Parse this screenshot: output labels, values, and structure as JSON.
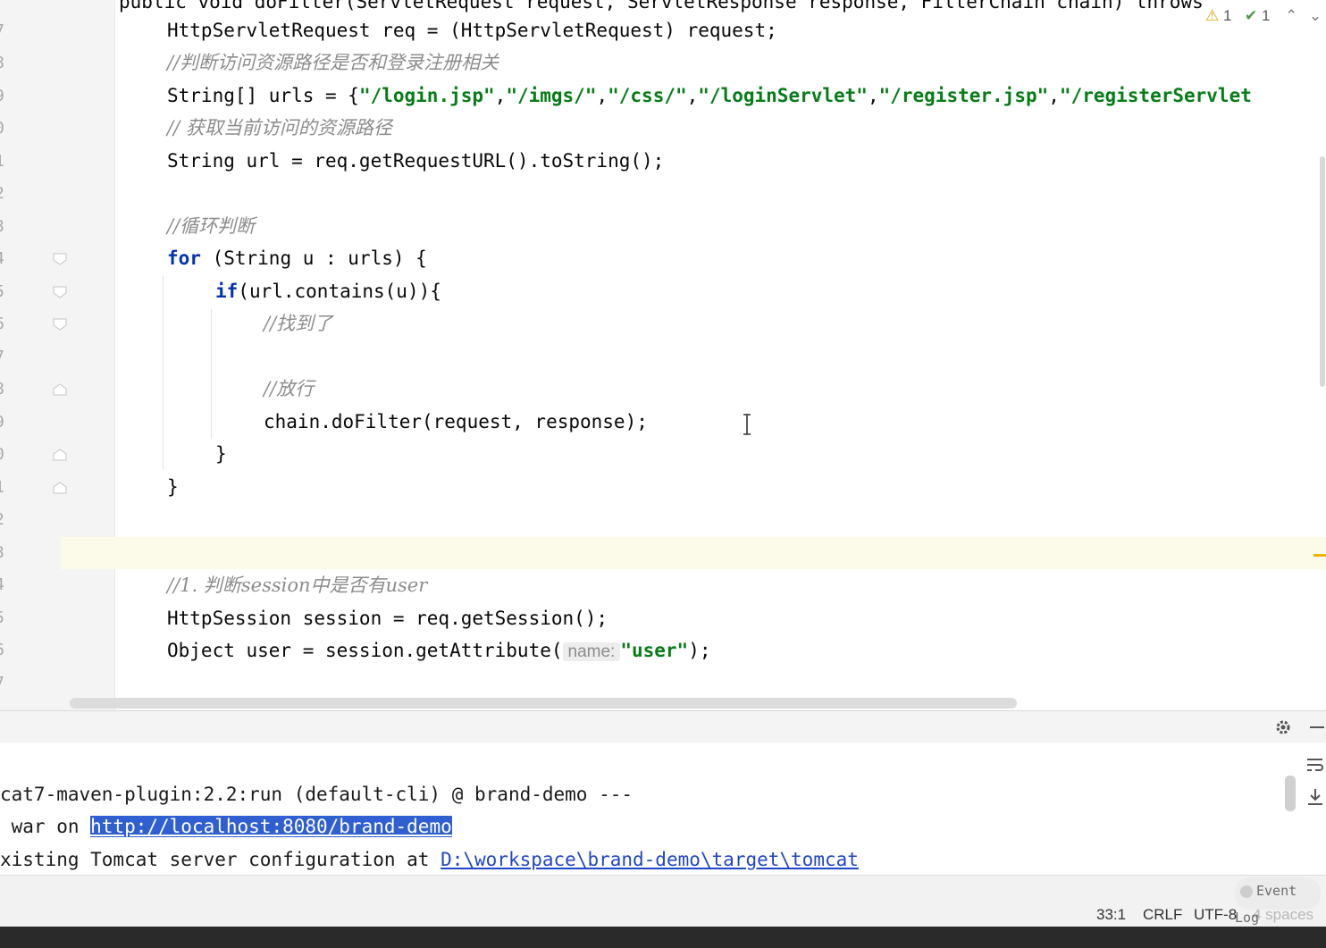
{
  "editor": {
    "line_numbers": [
      "7",
      "8",
      "9",
      "0",
      "1",
      "2",
      "3",
      "4",
      "5",
      "6",
      "7",
      "8",
      "9",
      "0",
      "1",
      "2",
      "3",
      "4",
      "5",
      "6",
      "7"
    ],
    "top_partial": "public void doFilter(ServletRequest request, ServletResponse response, FilterChain chain) throws",
    "code": {
      "l1": {
        "a": "HttpServletRequest req = (HttpServletRequest) request;"
      },
      "l2": {
        "c": "//判断访问资源路径是否和登录注册相关"
      },
      "l3": {
        "a": "String[] urls = {",
        "s1": "\"/login.jsp\"",
        "p1": ",",
        "s2": "\"/imgs/\"",
        "p2": ",",
        "s3": "\"/css/\"",
        "p3": ",",
        "s4": "\"/loginServlet\"",
        "p4": ",",
        "s5": "\"/register.jsp\"",
        "p5": ",",
        "s6": "\"/registerServlet"
      },
      "l4": {
        "c": "// 获取当前访问的资源路径"
      },
      "l5": {
        "a": "String url = req.getRequestURL().toString();"
      },
      "l6": {
        "c": "//循环判断"
      },
      "l7": {
        "k": "for",
        "a": " (String u : urls) {"
      },
      "l8": {
        "k": "if",
        "a": "(url.contains(u)){"
      },
      "l9": {
        "c": "//找到了"
      },
      "l10": {
        "c": "//放行"
      },
      "l11": {
        "a": "chain.doFilter(request, response);"
      },
      "l12": {
        "a": "}"
      },
      "l13": {
        "a": "}"
      },
      "l14": {
        "c": "//1. 判断session中是否有user"
      },
      "l15": {
        "a": "HttpSession session = req.getSession();"
      },
      "l16": {
        "a": "Object user = session.getAttribute(",
        "hint": "name:",
        "s": "\"user\"",
        "b": ");"
      }
    },
    "inspections": {
      "warnings": "1",
      "typos": "1"
    }
  },
  "console": {
    "line1": "cat7-maven-plugin:2.2:run (default-cli) @ brand-demo ---",
    "line2_prefix": " war on ",
    "line2_link": "http://localhost:8080/brand-demo",
    "line3_prefix": "xisting Tomcat server configuration at ",
    "line3_link": "D:\\workspace\\brand-demo\\target\\tomcat"
  },
  "statusbar": {
    "position": "33:1",
    "line_sep": "CRLF",
    "encoding": "UTF-8",
    "indent": "4 spaces",
    "event_log": "Event Log"
  }
}
